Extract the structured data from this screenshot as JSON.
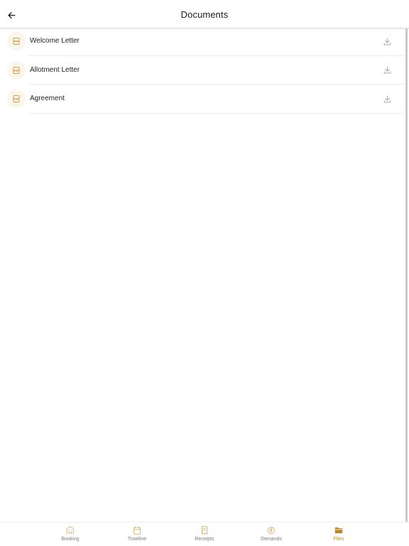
{
  "header": {
    "title": "Documents",
    "back_icon": "arrow-left-icon"
  },
  "documents": [
    {
      "label": "Welcome Letter",
      "icon": "pdf-file-icon",
      "action_icon": "download-icon"
    },
    {
      "label": "Allotment Letter",
      "icon": "pdf-file-icon",
      "action_icon": "download-icon"
    },
    {
      "label": "Agreement",
      "icon": "pdf-file-icon",
      "action_icon": "download-icon"
    }
  ],
  "bottom_nav": {
    "items": [
      {
        "label": "Booking",
        "icon": "building-icon"
      },
      {
        "label": "Timeline",
        "icon": "calendar-icon"
      },
      {
        "label": "Receipts",
        "icon": "receipt-icon"
      },
      {
        "label": "Demands",
        "icon": "rupee-demand-icon"
      },
      {
        "label": "Files",
        "icon": "folder-icon"
      }
    ],
    "active": "Files"
  },
  "colors": {
    "accent": "#b8862d",
    "icon_bg": "#fbf6ec",
    "text": "#1a1a1a",
    "muted": "#7a7a7a"
  }
}
